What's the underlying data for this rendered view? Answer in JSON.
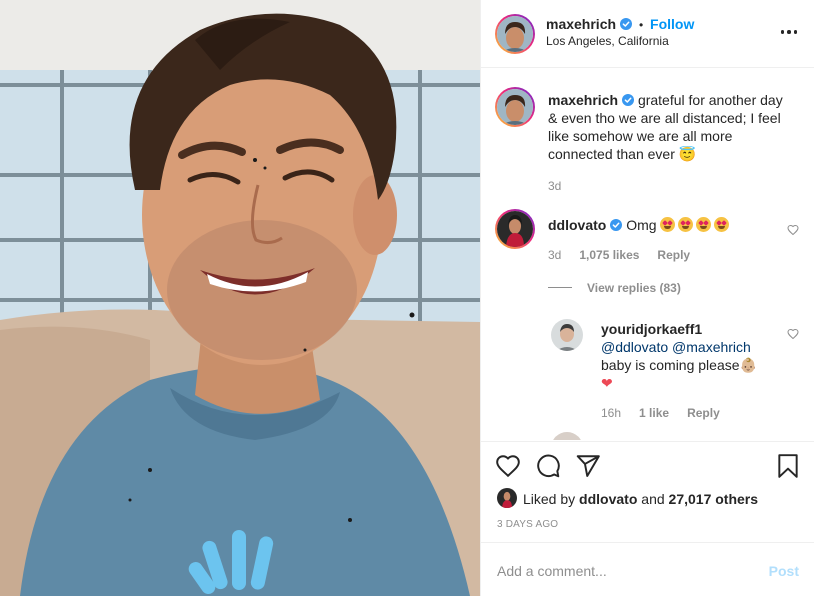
{
  "post": {
    "author": {
      "username": "maxehrich",
      "verified": true,
      "follow_label": "Follow",
      "separator": "•",
      "location": "Los Angeles, California"
    },
    "caption": {
      "username": "maxehrich",
      "text": "grateful for another day & even tho we are all distanced; I feel like somehow we are all more connected than ever 😇",
      "age": "3d"
    },
    "comments": [
      {
        "username": "ddlovato",
        "verified": true,
        "text": "Omg",
        "emoji": [
          "heart-eyes-emoji",
          "heart-eyes-emoji",
          "heart-eyes-emoji",
          "heart-eyes-emoji"
        ],
        "age": "3d",
        "likes": "1,075 likes",
        "reply_label": "Reply",
        "view_replies": "View replies (83)",
        "replies": [
          {
            "username": "youridjorkaeff1",
            "mentions": "@ddlovato @maxehrich",
            "text": "baby is coming please👶🏼",
            "age": "16h",
            "likes": "1 like",
            "reply_label": "Reply"
          }
        ]
      }
    ],
    "liked_by": {
      "prefix": "Liked by",
      "user": "ddlovato",
      "conjunction": "and",
      "others": "27,017 others"
    },
    "date": "3 DAYS AGO",
    "add_comment": {
      "placeholder": "Add a comment...",
      "post_label": "Post"
    },
    "colors": {
      "accent": "#0095f6",
      "text": "#262626",
      "muted": "#8e8e8e",
      "like_red": "#ed4956"
    },
    "icons": [
      "more-options-icon",
      "heart-icon",
      "comment-icon",
      "share-icon",
      "bookmark-icon",
      "verified-icon"
    ]
  }
}
